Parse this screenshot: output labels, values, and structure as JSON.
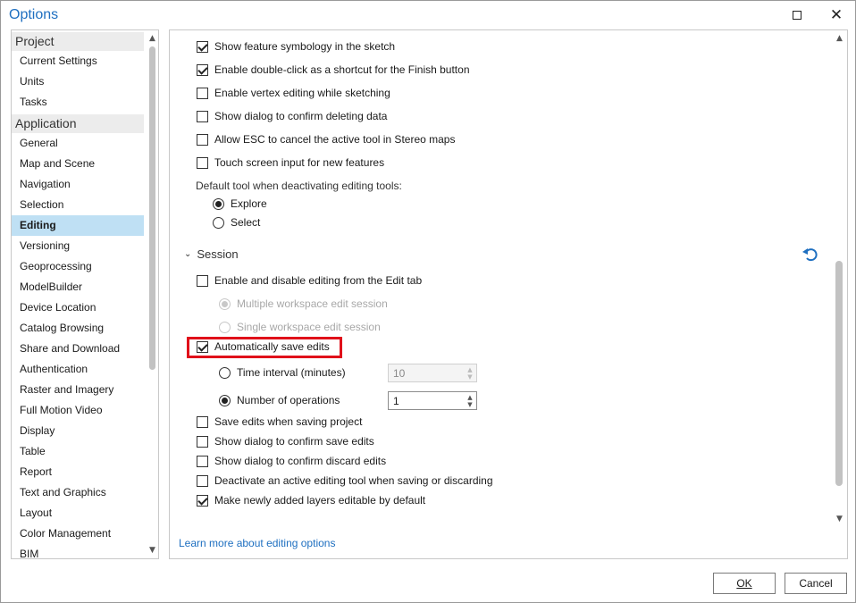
{
  "window": {
    "title": "Options"
  },
  "sidebar": {
    "groups": [
      {
        "label": "Project",
        "items": [
          "Current Settings",
          "Units",
          "Tasks"
        ]
      },
      {
        "label": "Application",
        "items": [
          "General",
          "Map and Scene",
          "Navigation",
          "Selection",
          "Editing",
          "Versioning",
          "Geoprocessing",
          "ModelBuilder",
          "Device Location",
          "Catalog Browsing",
          "Share and Download",
          "Authentication",
          "Raster and Imagery",
          "Full Motion Video",
          "Display",
          "Table",
          "Report",
          "Text and Graphics",
          "Layout",
          "Color Management",
          "BIM"
        ]
      }
    ],
    "selected": "Editing"
  },
  "content": {
    "top_options": [
      {
        "label": "Show feature symbology in the sketch",
        "checked": true
      },
      {
        "label": "Enable double-click as a shortcut for the Finish button",
        "checked": true
      },
      {
        "label": "Enable vertex editing while sketching",
        "checked": false
      },
      {
        "label": "Show dialog to confirm deleting data",
        "checked": false
      },
      {
        "label": "Allow ESC to cancel the active tool in Stereo maps",
        "checked": false
      },
      {
        "label": "Touch screen input for new features",
        "checked": false
      }
    ],
    "default_tool_label": "Default tool when deactivating editing tools:",
    "default_tool_options": [
      {
        "label": "Explore",
        "checked": true
      },
      {
        "label": "Select",
        "checked": false
      }
    ],
    "session": {
      "title": "Session",
      "enable_disable": {
        "label": "Enable and disable editing from the Edit tab",
        "checked": false
      },
      "workspace_options": [
        {
          "label": "Multiple workspace edit session",
          "checked": true,
          "disabled": true
        },
        {
          "label": "Single workspace edit session",
          "checked": false,
          "disabled": true
        }
      ],
      "auto_save": {
        "label": "Automatically save edits",
        "checked": true
      },
      "time_interval": {
        "label": "Time interval (minutes)",
        "checked": false,
        "value": "10"
      },
      "num_operations": {
        "label": "Number of operations",
        "checked": true,
        "value": "1"
      },
      "more_options": [
        {
          "label": "Save edits when saving project",
          "checked": false
        },
        {
          "label": "Show dialog to confirm save edits",
          "checked": false
        },
        {
          "label": "Show dialog to confirm discard edits",
          "checked": false
        },
        {
          "label": "Deactivate an active editing tool when saving or discarding",
          "checked": false
        },
        {
          "label": "Make newly added layers editable by default",
          "checked": true
        }
      ]
    },
    "learn_more_link": "Learn more about editing options"
  },
  "buttons": {
    "ok": "OK",
    "cancel": "Cancel"
  },
  "colors": {
    "accent": "#1e6fc0",
    "selection": "#bfe0f4",
    "highlight": "#e0101a"
  }
}
